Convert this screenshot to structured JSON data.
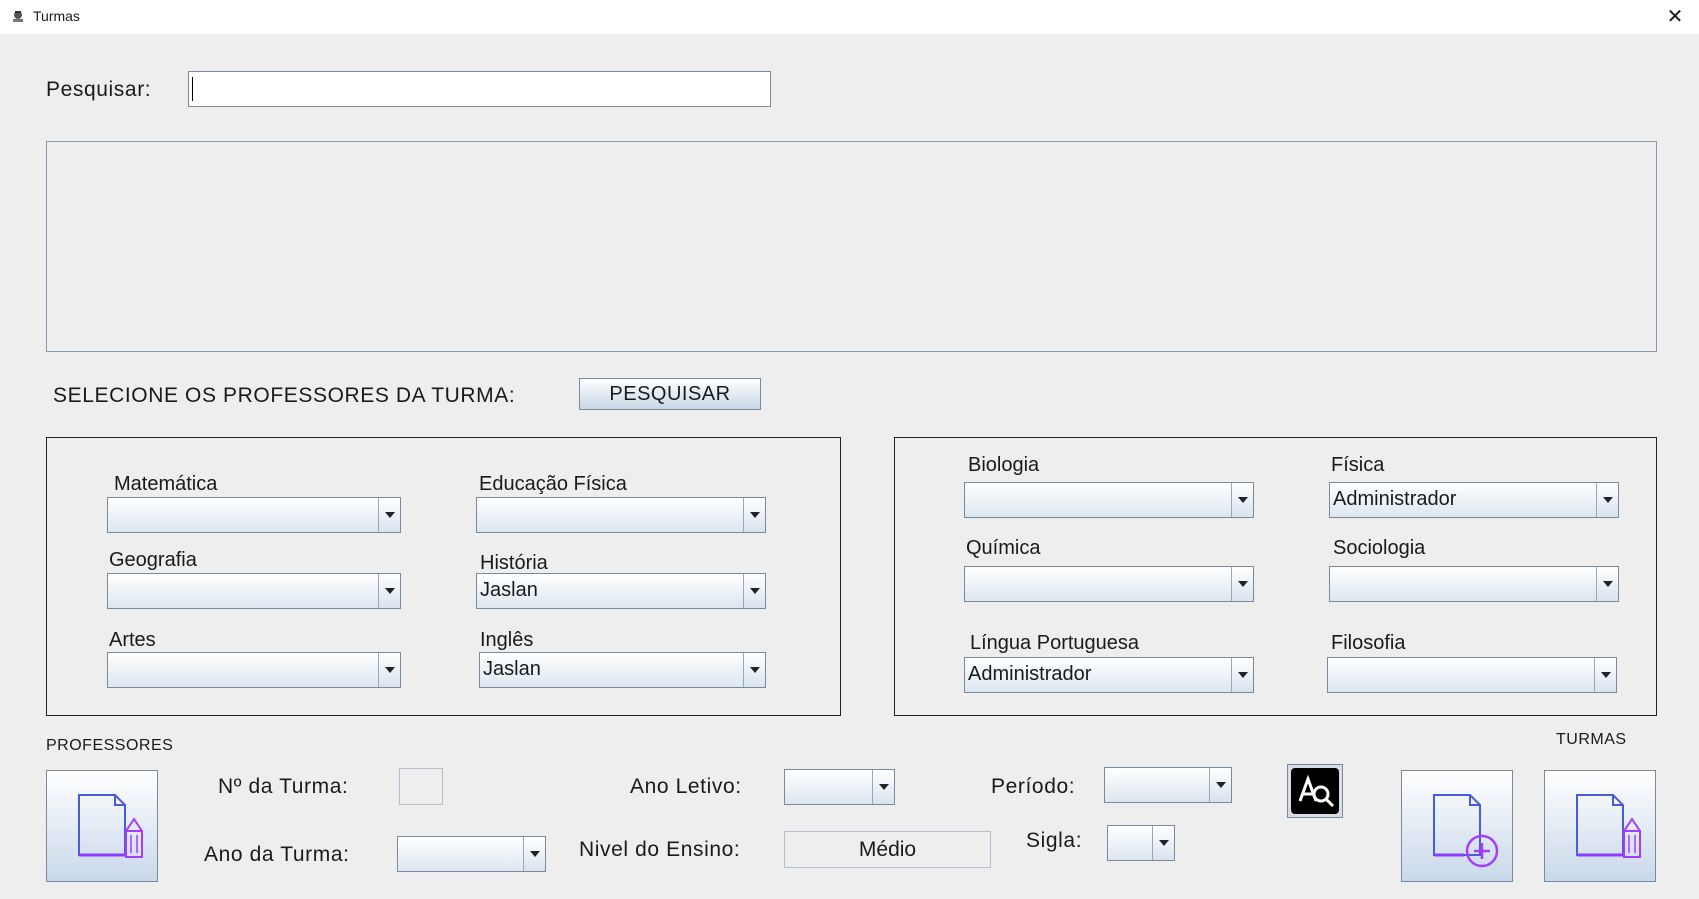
{
  "window": {
    "title": "Turmas",
    "close_glyph": "✕"
  },
  "search": {
    "label": "Pesquisar:",
    "value": ""
  },
  "teachers_prompt": "SELECIONE OS PROFESSORES DA TURMA:",
  "search_button": "PESQUISAR",
  "left_panel": {
    "matematica": {
      "label": "Matemática",
      "value": ""
    },
    "educacao_fisica": {
      "label": "Educação Física",
      "value": ""
    },
    "geografia": {
      "label": "Geografia",
      "value": ""
    },
    "historia": {
      "label": "História",
      "value": "Jaslan"
    },
    "artes": {
      "label": "Artes",
      "value": ""
    },
    "ingles": {
      "label": "Inglês",
      "value": "Jaslan"
    }
  },
  "right_panel": {
    "biologia": {
      "label": "Biologia",
      "value": ""
    },
    "fisica": {
      "label": "Física",
      "value": "Administrador"
    },
    "quimica": {
      "label": "Química",
      "value": ""
    },
    "sociologia": {
      "label": "Sociologia",
      "value": ""
    },
    "lingua_portuguesa": {
      "label": "Língua Portuguesa",
      "value": "Administrador"
    },
    "filosofia": {
      "label": "Filosofia",
      "value": ""
    }
  },
  "bottom": {
    "professores_label": "PROFESSORES",
    "turmas_label": "TURMAS",
    "numero_turma": {
      "label": "Nº da Turma:",
      "value": ""
    },
    "ano_turma": {
      "label": "Ano da Turma:",
      "value": ""
    },
    "ano_letivo": {
      "label": "Ano Letivo:",
      "value": ""
    },
    "nivel_ensino": {
      "label": "Nivel do Ensino:",
      "value": "Médio"
    },
    "periodo": {
      "label": "Período:",
      "value": ""
    },
    "sigla": {
      "label": "Sigla:",
      "value": ""
    }
  },
  "icons": {
    "professores_button": "edit-document-icon",
    "spellcheck_button": "spellcheck-icon",
    "new_turma_button": "add-document-icon",
    "edit_turma_button": "edit-document-icon"
  },
  "colors": {
    "accent": "#8b3dff",
    "doc_outline": "#4b5bd6",
    "spellcheck_bg": "#000000"
  }
}
